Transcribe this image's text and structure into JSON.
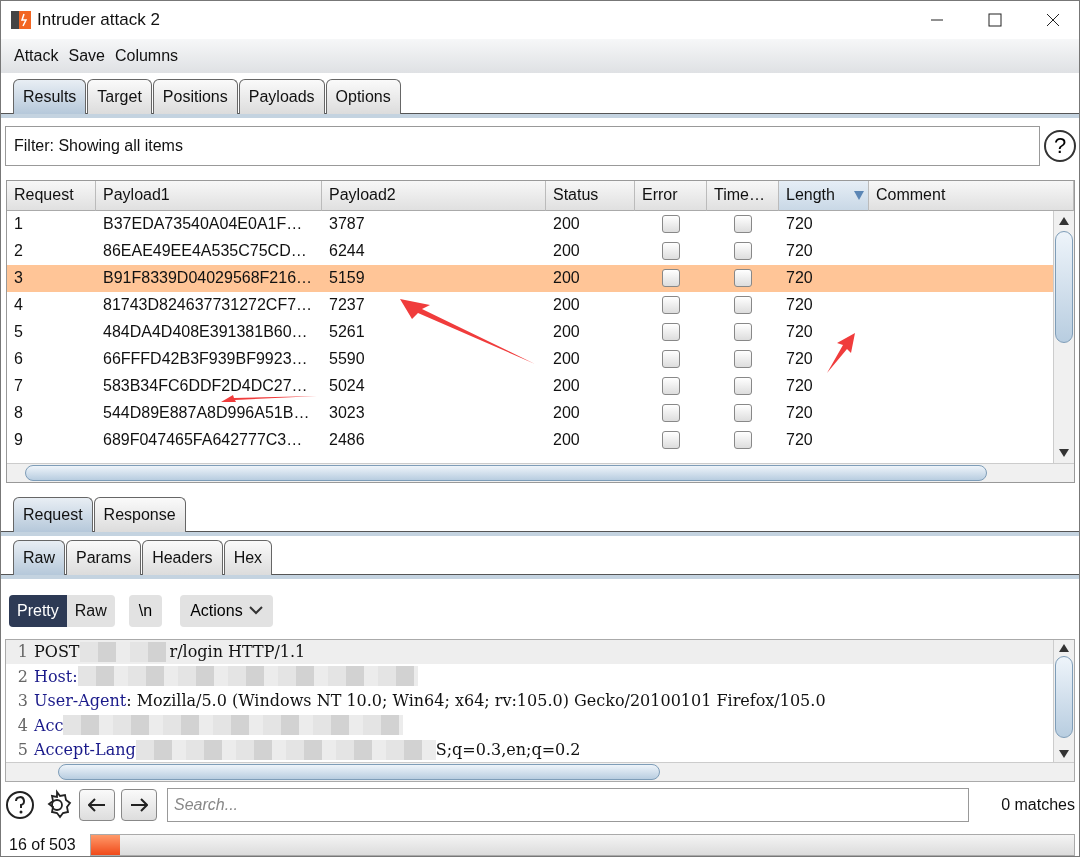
{
  "window": {
    "title": "Intruder attack 2"
  },
  "menu": [
    "Attack",
    "Save",
    "Columns"
  ],
  "tabs": [
    {
      "label": "Results",
      "selected": true
    },
    {
      "label": "Target",
      "selected": false
    },
    {
      "label": "Positions",
      "selected": false
    },
    {
      "label": "Payloads",
      "selected": false
    },
    {
      "label": "Options",
      "selected": false
    }
  ],
  "filter": {
    "text": "Filter: Showing all items",
    "help": "?"
  },
  "table": {
    "columns": [
      {
        "label": "Request",
        "sorted": false
      },
      {
        "label": "Payload1",
        "sorted": false
      },
      {
        "label": "Payload2",
        "sorted": false
      },
      {
        "label": "Status",
        "sorted": false
      },
      {
        "label": "Error",
        "sorted": false
      },
      {
        "label": "Time…",
        "sorted": false
      },
      {
        "label": "Length",
        "sorted": true
      },
      {
        "label": "Comment",
        "sorted": false
      }
    ],
    "rows": [
      {
        "request": "1",
        "payload1": "B37EDA73540A04E0A1F…",
        "payload2": "3787",
        "status": "200",
        "error": false,
        "timeout": false,
        "length": "720",
        "selected": false
      },
      {
        "request": "2",
        "payload1": "86EAE49EE4A535C75CD…",
        "payload2": "6244",
        "status": "200",
        "error": false,
        "timeout": false,
        "length": "720",
        "selected": false
      },
      {
        "request": "3",
        "payload1": "B91F8339D04029568F216…",
        "payload2": "5159",
        "status": "200",
        "error": false,
        "timeout": false,
        "length": "720",
        "selected": true
      },
      {
        "request": "4",
        "payload1": "81743D824637731272CF7…",
        "payload2": "7237",
        "status": "200",
        "error": false,
        "timeout": false,
        "length": "720",
        "selected": false
      },
      {
        "request": "5",
        "payload1": "484DA4D408E391381B60…",
        "payload2": "5261",
        "status": "200",
        "error": false,
        "timeout": false,
        "length": "720",
        "selected": false
      },
      {
        "request": "6",
        "payload1": "66FFFD42B3F939BF9923…",
        "payload2": "5590",
        "status": "200",
        "error": false,
        "timeout": false,
        "length": "720",
        "selected": false
      },
      {
        "request": "7",
        "payload1": "583B34FC6DDF2D4DC27…",
        "payload2": "5024",
        "status": "200",
        "error": false,
        "timeout": false,
        "length": "720",
        "selected": false
      },
      {
        "request": "8",
        "payload1": "544D89E887A8D996A51B…",
        "payload2": "3023",
        "status": "200",
        "error": false,
        "timeout": false,
        "length": "720",
        "selected": false
      },
      {
        "request": "9",
        "payload1": "689F047465FA642777C3…",
        "payload2": "2486",
        "status": "200",
        "error": false,
        "timeout": false,
        "length": "720",
        "selected": false
      }
    ]
  },
  "annotations": [
    {
      "kind": "arrow"
    },
    {
      "kind": "arrow"
    },
    {
      "kind": "arrow"
    }
  ],
  "message_tabs": [
    {
      "label": "Request",
      "selected": true
    },
    {
      "label": "Response",
      "selected": false
    }
  ],
  "view_tabs": [
    {
      "label": "Raw",
      "selected": true
    },
    {
      "label": "Params",
      "selected": false
    },
    {
      "label": "Headers",
      "selected": false
    },
    {
      "label": "Hex",
      "selected": false
    }
  ],
  "editor_toolbar": {
    "modes": [
      {
        "label": "Pretty",
        "selected": true
      },
      {
        "label": "Raw",
        "selected": false
      }
    ],
    "newline": "\\n",
    "actions": "Actions"
  },
  "code_lines": [
    {
      "number": "1",
      "parts": [
        {
          "kind": "text",
          "text": "POST"
        },
        {
          "kind": "redacted"
        },
        {
          "kind": "text",
          "text": "r/login HTTP/1.1"
        }
      ]
    },
    {
      "number": "2",
      "parts": [
        {
          "kind": "key",
          "text": "Host:"
        },
        {
          "kind": "redacted"
        }
      ]
    },
    {
      "number": "3",
      "parts": [
        {
          "kind": "key",
          "text": "User-Agent"
        },
        {
          "kind": "text",
          "text": ": Mozilla/5.0 (Windows NT 10.0; Win64; x64; rv:105.0) Gecko/20100101 Firefox/105.0"
        }
      ]
    },
    {
      "number": "4",
      "parts": [
        {
          "kind": "key",
          "text": "Acc"
        },
        {
          "kind": "redacted"
        }
      ]
    },
    {
      "number": "5",
      "parts": [
        {
          "kind": "key",
          "text": "Accept-Lang"
        },
        {
          "kind": "redacted"
        },
        {
          "kind": "text",
          "text": "S;q=0.3,en;q=0.2"
        }
      ]
    }
  ],
  "search": {
    "placeholder": "Search...",
    "matches": "0 matches"
  },
  "status": {
    "text": "16 of 503",
    "level": 0.03
  }
}
